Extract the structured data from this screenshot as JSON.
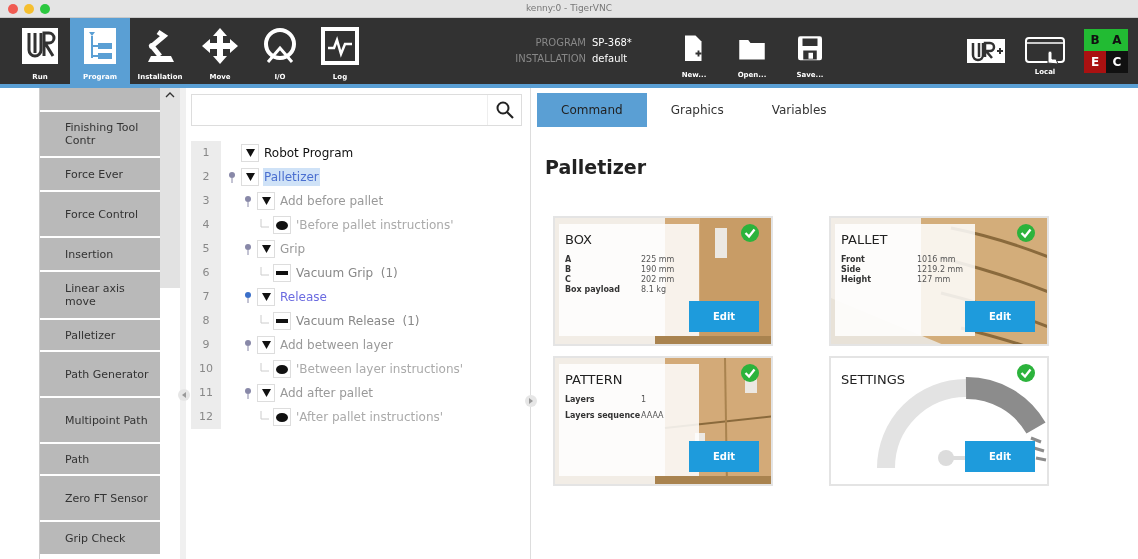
{
  "window": {
    "title": "kenny:0 - TigerVNC"
  },
  "toolbar": {
    "tabs": [
      {
        "label": "Run",
        "selected": false
      },
      {
        "label": "Program",
        "selected": true
      },
      {
        "label": "Installation",
        "selected": false
      },
      {
        "label": "Move",
        "selected": false
      },
      {
        "label": "I/O",
        "selected": false
      },
      {
        "label": "Log",
        "selected": false
      }
    ],
    "program_label": "PROGRAM",
    "program_value": "SP-368*",
    "installation_label": "INSTALLATION",
    "installation_value": "default",
    "file_buttons": [
      {
        "label": "New..."
      },
      {
        "label": "Open..."
      },
      {
        "label": "Save..."
      }
    ],
    "local_label": "Local",
    "status_grid": [
      {
        "text": "B",
        "color": "#22bb33"
      },
      {
        "text": "A",
        "color": "#22bb33"
      },
      {
        "text": "E",
        "color": "#aa1111"
      },
      {
        "text": "C",
        "color": "#111111"
      }
    ]
  },
  "sidebar": {
    "items": [
      {
        "label": "Finishing Tool Contr"
      },
      {
        "label": "Force Ever"
      },
      {
        "label": "Force Control"
      },
      {
        "label": "Insertion"
      },
      {
        "label": "Linear axis move"
      },
      {
        "label": "Palletizer"
      },
      {
        "label": "Path Generator"
      },
      {
        "label": "Multipoint Path"
      },
      {
        "label": "Path"
      },
      {
        "label": "Zero FT Sensor"
      },
      {
        "label": "Grip Check"
      }
    ]
  },
  "tree": [
    {
      "line": "1",
      "label": "Robot Program",
      "kind": "root",
      "selected": false,
      "active": false,
      "children": [
        {
          "line": "2",
          "label": "Palletizer",
          "kind": "folder",
          "selected": true,
          "active": false,
          "children": [
            {
              "line": "3",
              "label": "Add before pallet",
              "kind": "folder",
              "selected": false,
              "active": false,
              "children": [
                {
                  "line": "4",
                  "label": "'Before pallet instructions'",
                  "kind": "comment",
                  "selected": false,
                  "active": false
                }
              ]
            },
            {
              "line": "5",
              "label": "Grip",
              "kind": "folder",
              "selected": false,
              "active": false,
              "children": [
                {
                  "line": "6",
                  "label": "Vacuum Grip  (1)",
                  "kind": "vacuum",
                  "selected": false,
                  "active": false
                }
              ]
            },
            {
              "line": "7",
              "label": "Release",
              "kind": "folder",
              "selected": false,
              "active": true,
              "children": [
                {
                  "line": "8",
                  "label": "Vacuum Release  (1)",
                  "kind": "vacuum",
                  "selected": false,
                  "active": false
                }
              ]
            },
            {
              "line": "9",
              "label": "Add between layer",
              "kind": "folder",
              "selected": false,
              "active": false,
              "children": [
                {
                  "line": "10",
                  "label": "'Between layer instructions'",
                  "kind": "comment",
                  "selected": false,
                  "active": false
                }
              ]
            },
            {
              "line": "11",
              "label": "Add after pallet",
              "kind": "folder",
              "selected": false,
              "active": false,
              "children": [
                {
                  "line": "12",
                  "label": "'After pallet instructions'",
                  "kind": "comment",
                  "selected": false,
                  "active": false
                }
              ]
            }
          ]
        }
      ]
    }
  ],
  "tabs": [
    {
      "label": "Command",
      "selected": true
    },
    {
      "label": "Graphics",
      "selected": false
    },
    {
      "label": "Variables",
      "selected": false
    }
  ],
  "heading": "Palletizer",
  "cards": [
    {
      "title": "BOX",
      "kind": "box",
      "done": true,
      "fields": [
        [
          "A",
          "225 mm"
        ],
        [
          "B",
          "190 mm"
        ],
        [
          "C",
          "202 mm"
        ],
        [
          "Box payload",
          "8.1 kg"
        ]
      ],
      "button": "Edit"
    },
    {
      "title": "PALLET",
      "kind": "pallet",
      "done": true,
      "fields": [
        [
          "Front",
          "1016 mm"
        ],
        [
          "Side",
          "1219.2 mm"
        ],
        [
          "Height",
          "127 mm"
        ]
      ],
      "button": "Edit"
    },
    {
      "title": "PATTERN",
      "kind": "pattern",
      "done": true,
      "fields": [
        [
          "Layers",
          "1"
        ],
        [
          "Layers sequence",
          "AAAA"
        ]
      ],
      "button": "Edit"
    },
    {
      "title": "SETTINGS",
      "kind": "settings",
      "done": true,
      "button": "Edit"
    }
  ]
}
